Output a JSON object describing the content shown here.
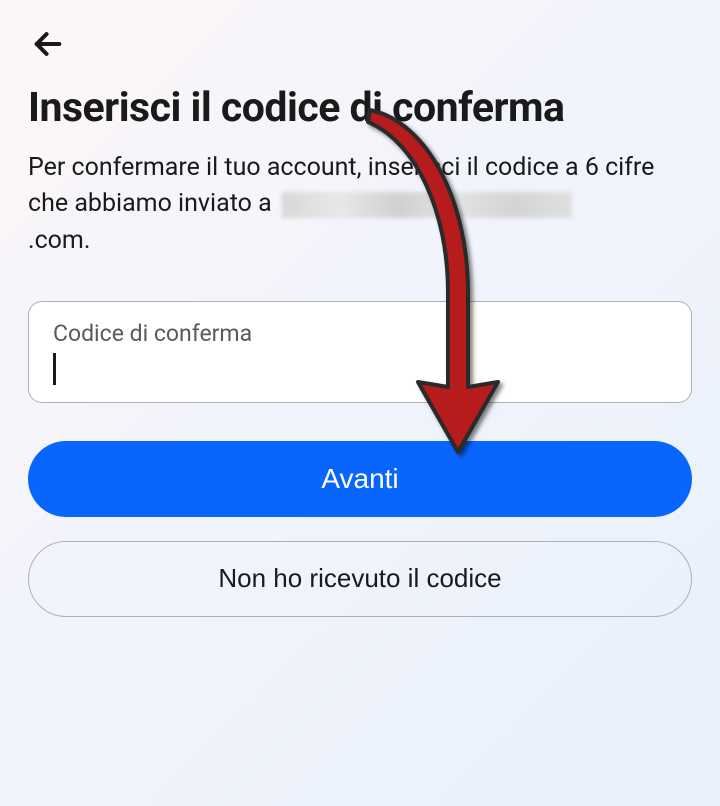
{
  "header": {
    "title": "Inserisci il codice di conferma",
    "subtitle_pre": "Per confermare il tuo account, inserisci il codice a 6 cifre che abbiamo inviato a",
    "subtitle_post": ".com."
  },
  "input": {
    "label": "Codice di conferma",
    "value": ""
  },
  "buttons": {
    "primary": "Avanti",
    "secondary": "Non ho ricevuto il codice"
  }
}
